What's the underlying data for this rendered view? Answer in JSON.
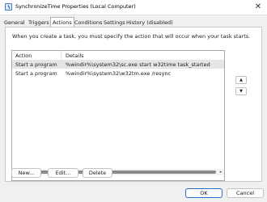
{
  "window": {
    "title": "SynchronizeTime Properties (Local Computer)",
    "close_glyph": "✕",
    "icon": "task-scheduler-icon"
  },
  "tabs": [
    {
      "label": "General"
    },
    {
      "label": "Triggers"
    },
    {
      "label": "Actions",
      "active": true
    },
    {
      "label": "Conditions"
    },
    {
      "label": "Settings"
    },
    {
      "label": "History (disabled)"
    }
  ],
  "panel": {
    "instructions": "When you create a task, you must specify the action that will occur when your task starts."
  },
  "actions_list": {
    "columns": [
      "Action",
      "Details"
    ],
    "rows": [
      {
        "action": "Start a program",
        "details": "%windir%\\system32\\sc.exe start w32time task_started"
      },
      {
        "action": "Start a program",
        "details": "%windir%\\system32\\w32tm.exe /resync"
      }
    ]
  },
  "scrollbar": {
    "left_glyph": "◂",
    "right_glyph": "▸"
  },
  "move_buttons": {
    "up_glyph": "▲",
    "down_glyph": "▼"
  },
  "action_buttons": {
    "new": "New...",
    "edit": "Edit...",
    "delete": "Delete"
  },
  "footer": {
    "ok": "OK",
    "cancel": "Cancel"
  },
  "colors": {
    "accent": "#2a6fc7",
    "selected_row": "#e5e5e5"
  }
}
